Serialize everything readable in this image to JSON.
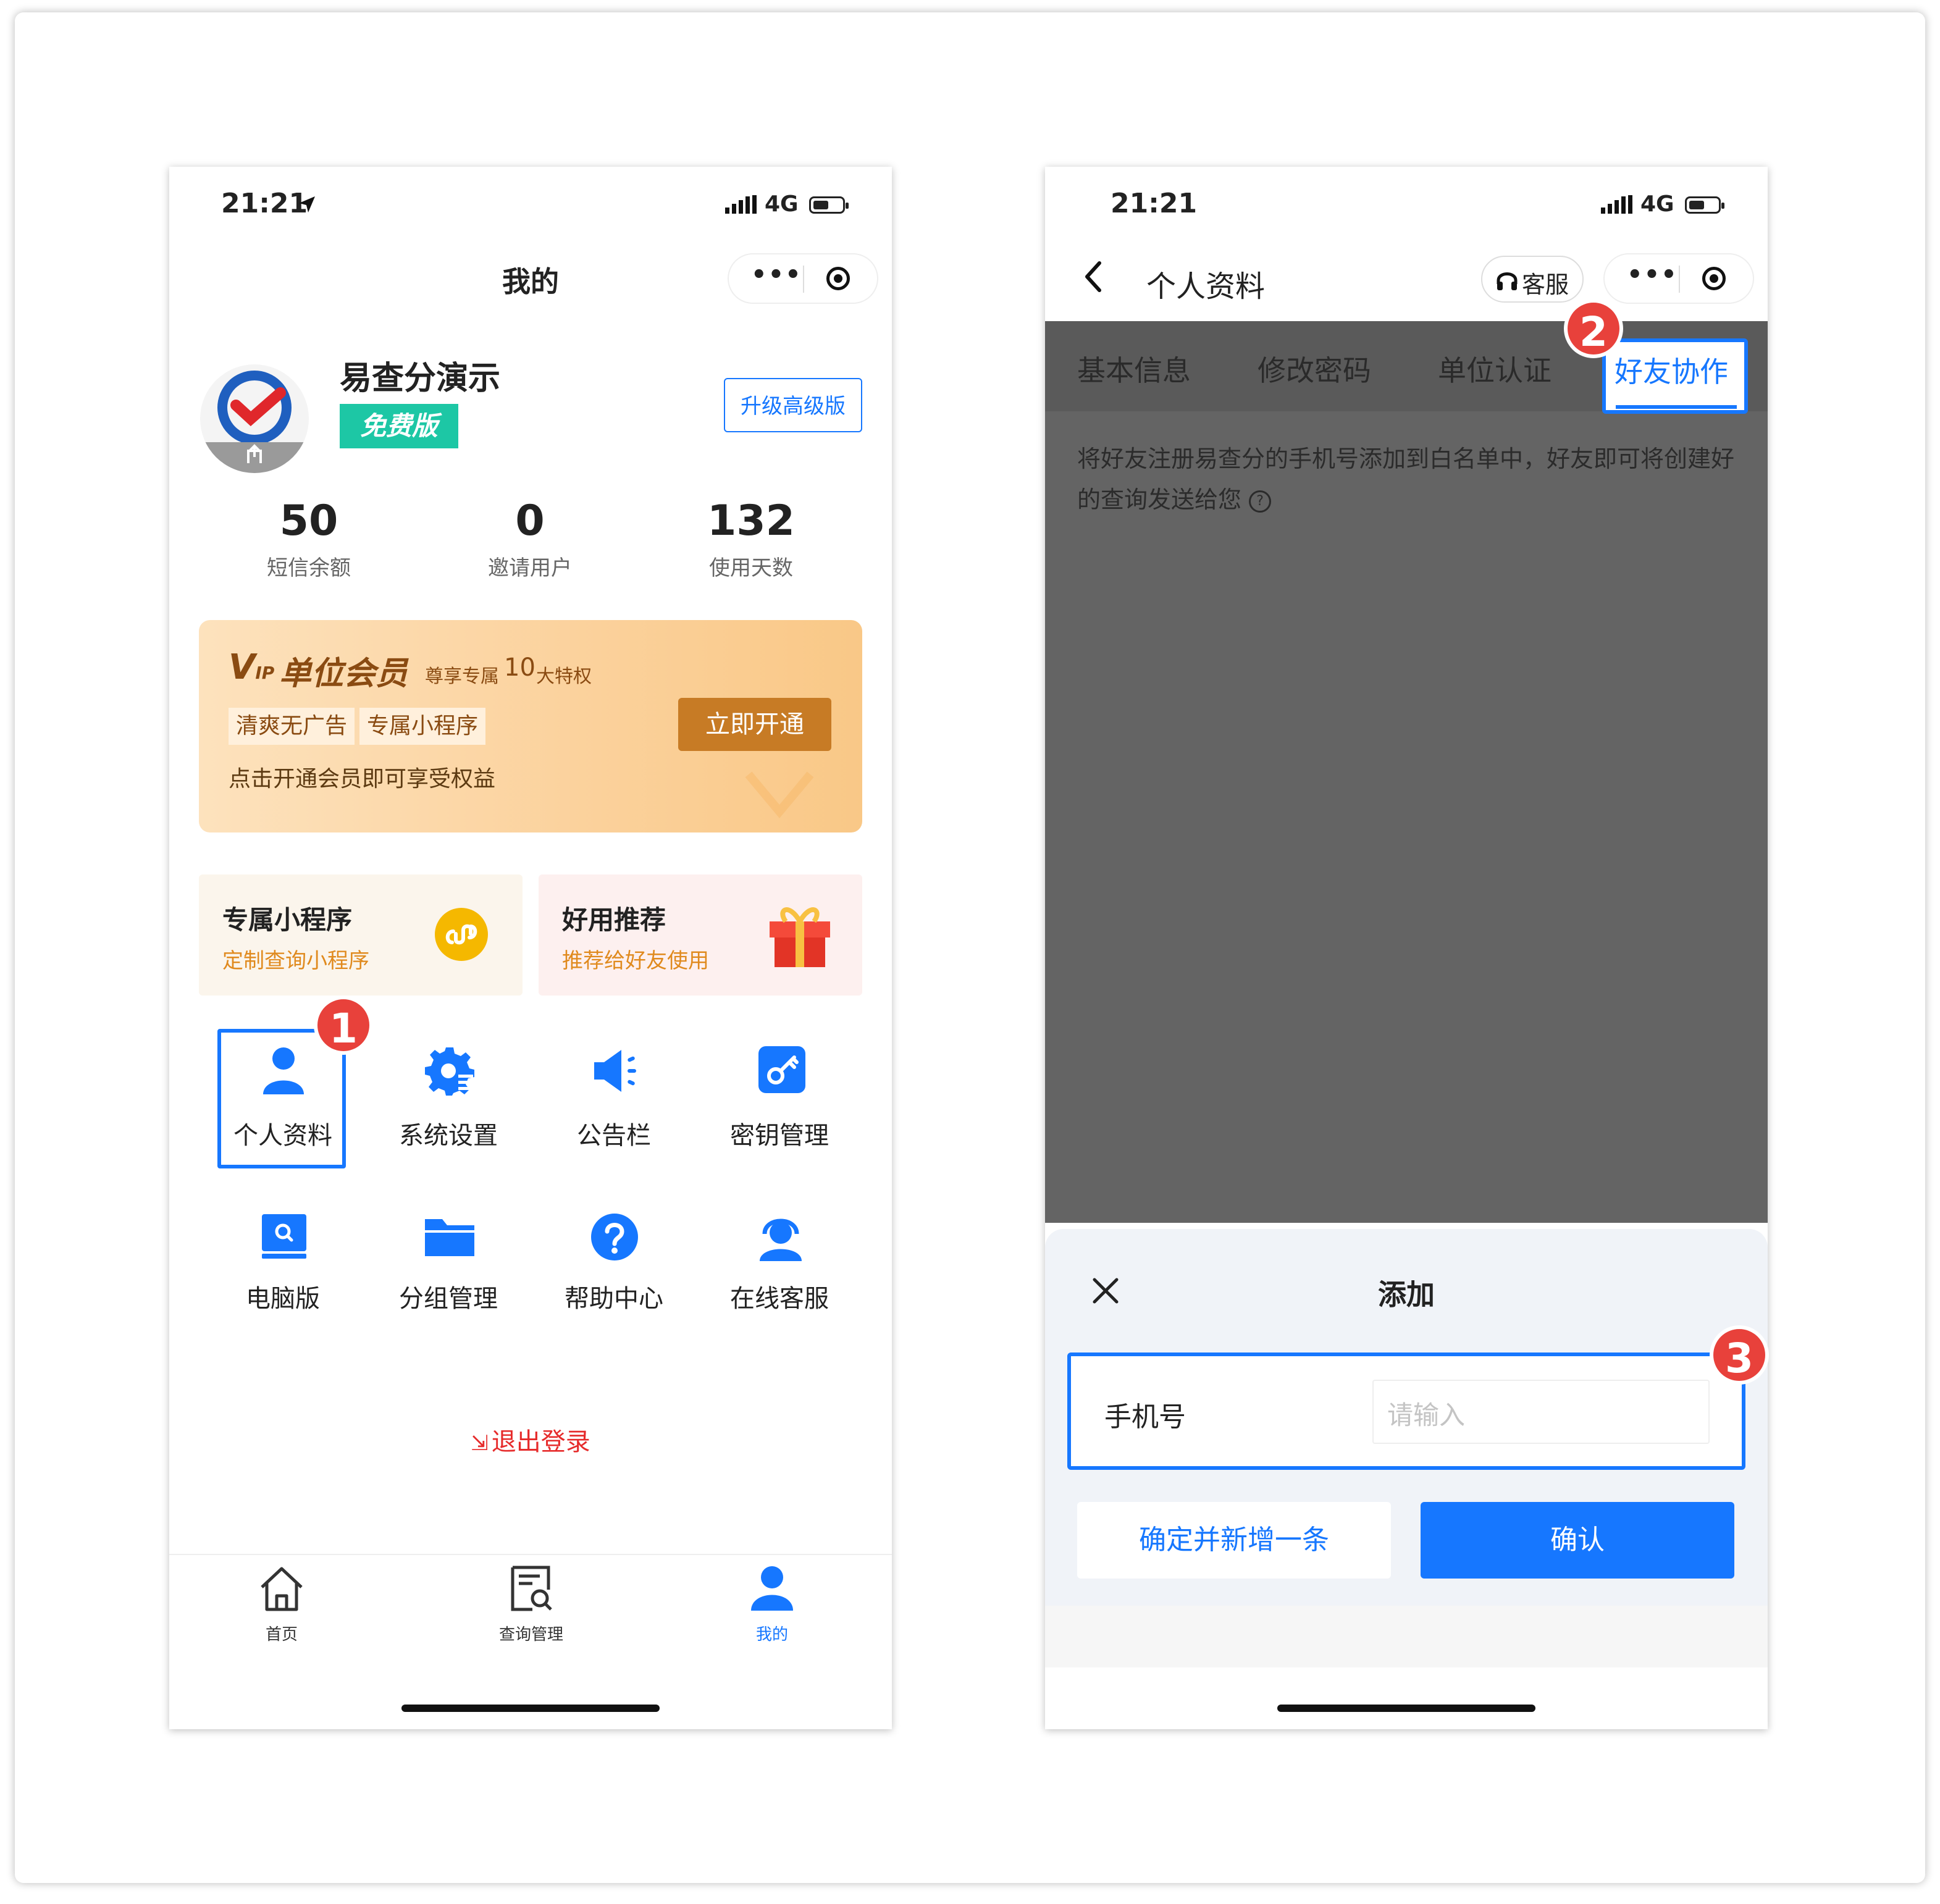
{
  "left": {
    "status": {
      "time": "21:21",
      "network": "4G"
    },
    "nav_title": "我的",
    "profile": {
      "name": "易查分演示",
      "plan_badge": "免费版",
      "upgrade_button": "升级高级版"
    },
    "stats": [
      {
        "value": "50",
        "label": "短信余额"
      },
      {
        "value": "0",
        "label": "邀请用户"
      },
      {
        "value": "132",
        "label": "使用天数"
      }
    ],
    "vip": {
      "title": "单位会员",
      "subtitle_prefix": "尊享专属",
      "subtitle_num": "10",
      "subtitle_suffix": "大特权",
      "tags": [
        "清爽无广告",
        "专属小程序"
      ],
      "desc": "点击开通会员即可享受权益",
      "cta": "立即开通"
    },
    "promo_cards": [
      {
        "title": "专属小程序",
        "subtitle": "定制查询小程序"
      },
      {
        "title": "好用推荐",
        "subtitle": "推荐给好友使用"
      }
    ],
    "grid": [
      {
        "label": "个人资料",
        "icon": "person-icon"
      },
      {
        "label": "系统设置",
        "icon": "gear-icon"
      },
      {
        "label": "公告栏",
        "icon": "megaphone-icon"
      },
      {
        "label": "密钥管理",
        "icon": "key-icon"
      },
      {
        "label": "电脑版",
        "icon": "monitor-icon"
      },
      {
        "label": "分组管理",
        "icon": "folder-icon"
      },
      {
        "label": "帮助中心",
        "icon": "help-icon"
      },
      {
        "label": "在线客服",
        "icon": "support-agent-icon"
      }
    ],
    "logout": "退出登录",
    "tabbar": [
      {
        "label": "首页",
        "icon": "home-icon"
      },
      {
        "label": "查询管理",
        "icon": "query-icon"
      },
      {
        "label": "我的",
        "icon": "person-icon"
      }
    ],
    "badge": "1"
  },
  "right": {
    "status": {
      "time": "21:21",
      "network": "4G"
    },
    "nav_title": "个人资料",
    "service_button": "客服",
    "tabs": [
      "基本信息",
      "修改密码",
      "单位认证",
      "好友协作"
    ],
    "description": "将好友注册易查分的手机号添加到白名单中，好友即可将创建好的查询发送给您",
    "sheet": {
      "title": "添加",
      "field_label": "手机号",
      "field_placeholder": "请输入",
      "secondary_button": "确定并新增一条",
      "primary_button": "确认"
    },
    "badges": [
      "2",
      "3"
    ]
  },
  "colors": {
    "brand_blue": "#1677ff",
    "badge_red": "#e8413b",
    "vip_gold": "#c77b25"
  }
}
